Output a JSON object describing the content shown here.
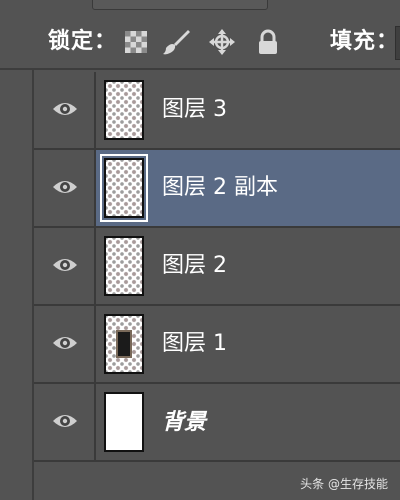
{
  "toolbar": {
    "lock_label": "锁定：",
    "fill_label": "填充：",
    "lock_icons": [
      "lock-transparent-pixels-icon",
      "lock-image-pixels-icon",
      "lock-position-icon",
      "lock-all-icon"
    ]
  },
  "layers": [
    {
      "name": "图层 3",
      "visible": true,
      "selected": false,
      "thumb": "checker"
    },
    {
      "name": "图层 2 副本",
      "visible": true,
      "selected": true,
      "thumb": "checker"
    },
    {
      "name": "图层 2",
      "visible": true,
      "selected": false,
      "thumb": "checker"
    },
    {
      "name": "图层 1",
      "visible": true,
      "selected": false,
      "thumb": "checker-with-mark"
    },
    {
      "name": "背景",
      "visible": true,
      "selected": false,
      "thumb": "white"
    }
  ],
  "watermark": "头条 @生存技能",
  "colors": {
    "panel_bg": "#535353",
    "selected_bg": "#5a6a85",
    "divider": "#3a3a3a",
    "text": "#ffffff"
  }
}
